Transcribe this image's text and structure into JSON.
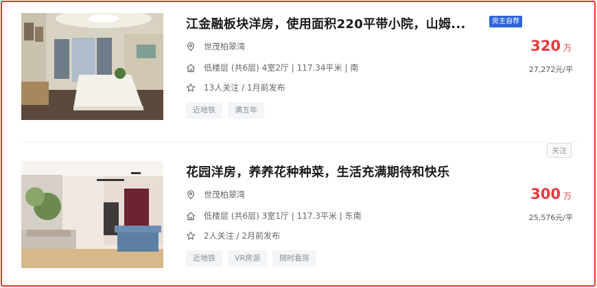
{
  "listings": [
    {
      "title": "江金融板块洋房，使用面积220平带小院，山姆...",
      "badge": "房主自荐",
      "community": "世茂柏翠湾",
      "info": "低楼层 (共6层) 4室2厅 | 117.34平米 | 南",
      "follow": "13人关注 / 1月前发布",
      "tags": [
        "近地铁",
        "满五年"
      ],
      "price": "320",
      "price_unit": "万",
      "unit_price": "27,272元/平"
    },
    {
      "title": "花园洋房，养养花种种菜，生活充满期待和快乐",
      "follow_button": "关注",
      "community": "世茂柏翠湾",
      "info": "低楼层 (共6层) 3室1厅 | 117.3平米 | 东南",
      "follow": "2人关注 / 2月前发布",
      "tags": [
        "近地铁",
        "VR房源",
        "随时看房"
      ],
      "price": "300",
      "price_unit": "万",
      "unit_price": "25,576元/平"
    }
  ],
  "icons": {
    "location": "location-pin-icon",
    "house": "house-icon",
    "star": "star-icon"
  },
  "colors": {
    "price": "#e4393c",
    "badge": "#2d64d6",
    "frame": "#e0342b"
  }
}
